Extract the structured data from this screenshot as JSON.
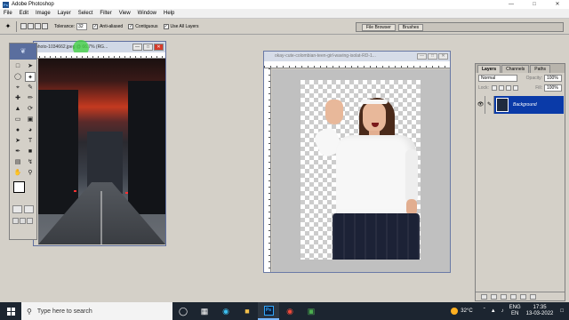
{
  "window": {
    "title": "Adobe Photoshop",
    "controls": [
      "—",
      "□",
      "✕"
    ]
  },
  "menu": [
    "File",
    "Edit",
    "Image",
    "Layer",
    "Select",
    "Filter",
    "View",
    "Window",
    "Help"
  ],
  "options": {
    "tolerance_label": "Tolerance:",
    "tolerance_value": "32",
    "anti_aliased": "Anti-aliased",
    "contiguous": "Contiguous",
    "use_all_layers": "Use All Layers",
    "palette_tabs": [
      "File Browser",
      "Brushes"
    ]
  },
  "doc1": {
    "title": "photo-1034662.jpeg @ 66.7% (RG..."
  },
  "doc2": {
    "title": "okay-cute-colombian-teen-girl-waving-isolat-RD-1..."
  },
  "layers": {
    "tabs": [
      "Layers",
      "Channels",
      "Paths"
    ],
    "blend_mode": "Normal",
    "opacity_label": "Opacity:",
    "opacity_value": "100%",
    "lock_label": "Lock:",
    "fill_label": "Fill:",
    "fill_value": "100%",
    "layer_name": "Background"
  },
  "taskbar": {
    "search_placeholder": "Type here to search",
    "weather": "32°C",
    "language": "ENG",
    "region": "EN",
    "time": "17:35",
    "date": "13-03-2022"
  },
  "colors": {
    "foreground": "#ffffff",
    "background": "#1a1ad8",
    "layer_selected": "#0a3aa8"
  }
}
